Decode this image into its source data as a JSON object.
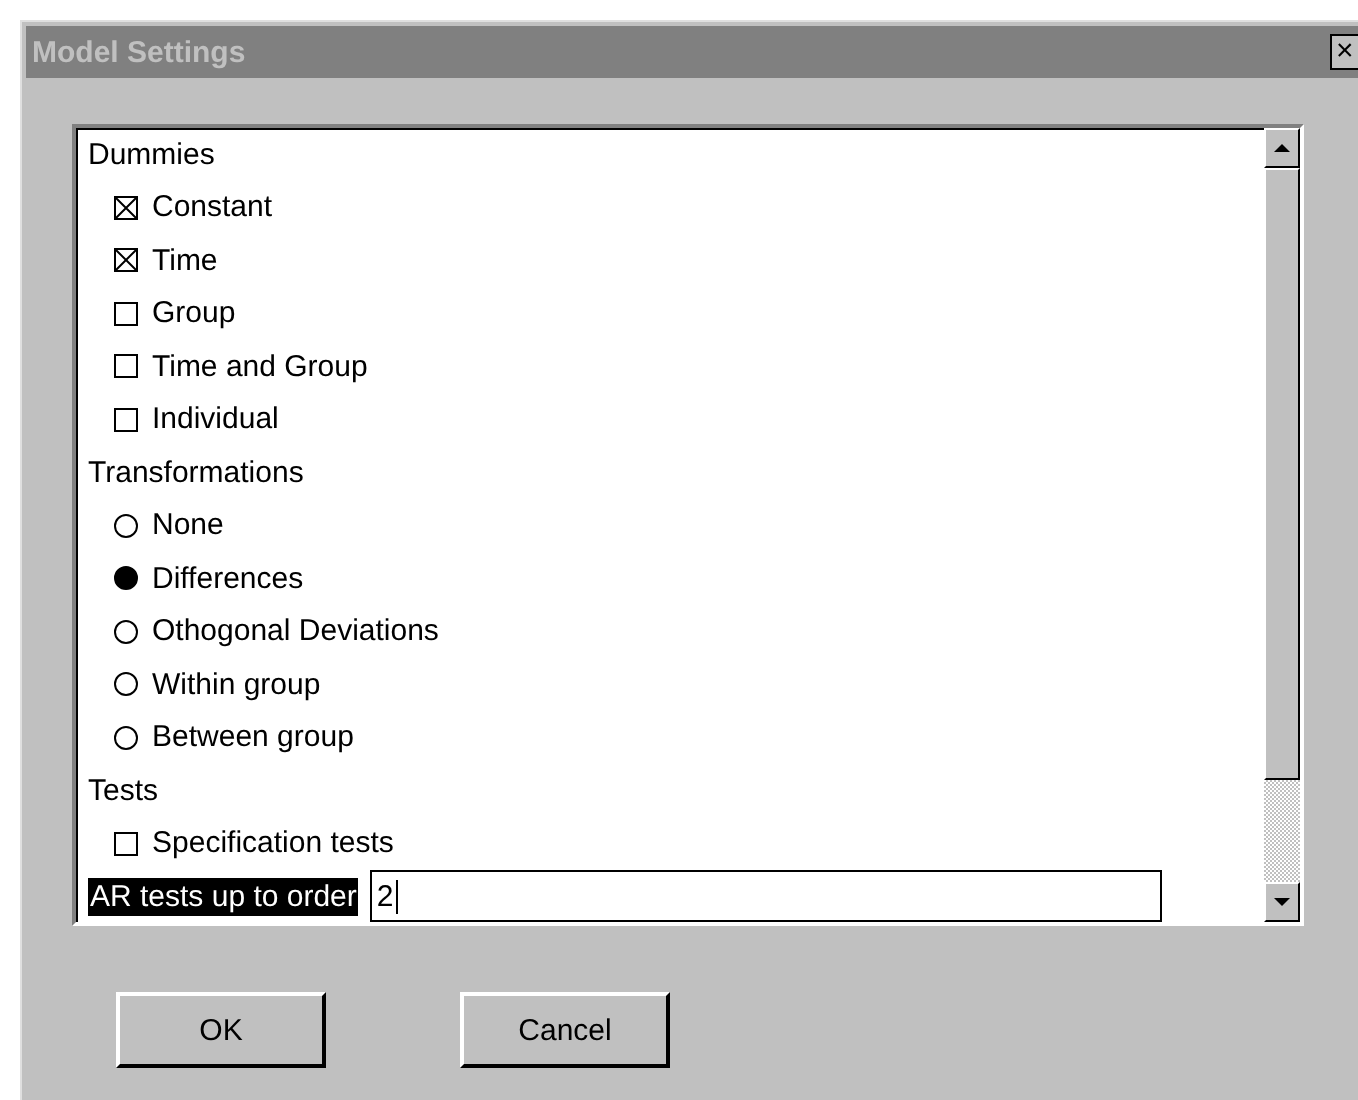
{
  "window": {
    "title": "Model Settings",
    "close": "×"
  },
  "sections": [
    {
      "title": "Dummies",
      "items": [
        {
          "kind": "checkbox",
          "label": "Constant",
          "checked": true
        },
        {
          "kind": "checkbox",
          "label": "Time",
          "checked": true
        },
        {
          "kind": "checkbox",
          "label": "Group",
          "checked": false
        },
        {
          "kind": "checkbox",
          "label": "Time and Group",
          "checked": false
        },
        {
          "kind": "checkbox",
          "label": "Individual",
          "checked": false
        }
      ]
    },
    {
      "title": "Transformations",
      "items": [
        {
          "kind": "radio",
          "label": "None",
          "selected": false
        },
        {
          "kind": "radio",
          "label": "Differences",
          "selected": true
        },
        {
          "kind": "radio",
          "label": "Othogonal Deviations",
          "selected": false
        },
        {
          "kind": "radio",
          "label": "Within group",
          "selected": false
        },
        {
          "kind": "radio",
          "label": "Between group",
          "selected": false
        }
      ]
    },
    {
      "title": "Tests",
      "items": [
        {
          "kind": "checkbox",
          "label": "Specification tests",
          "checked": false
        },
        {
          "kind": "input",
          "label": "AR tests up to order",
          "value": "2"
        }
      ]
    }
  ],
  "buttons": [
    "OK",
    "Cancel"
  ]
}
